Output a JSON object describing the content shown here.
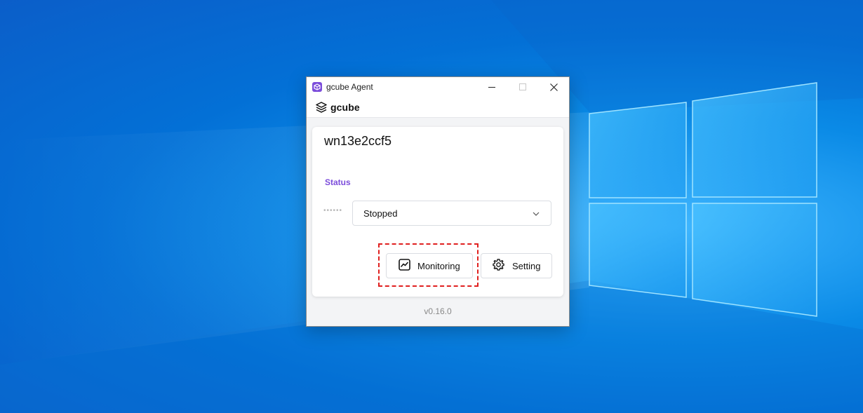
{
  "window": {
    "title": "gcube Agent",
    "icon": "gcube-app-icon",
    "controls": [
      "minimize-icon",
      "maximize-icon",
      "close-icon"
    ]
  },
  "brand": {
    "name": "gcube",
    "icon": "gcube-logo-icon"
  },
  "agent": {
    "hostname": "wn13e2ccf5",
    "status_label": "Status",
    "status_indicator": "••••••",
    "status_value": "Stopped"
  },
  "actions": {
    "monitoring_label": "Monitoring",
    "monitoring_icon": "chart-line-icon",
    "setting_label": "Setting",
    "setting_icon": "gear-icon"
  },
  "version": "v0.16.0",
  "colors": {
    "accent": "#7c4ddb",
    "highlight": "#e0201f",
    "desktop": "#0a8ae6"
  }
}
